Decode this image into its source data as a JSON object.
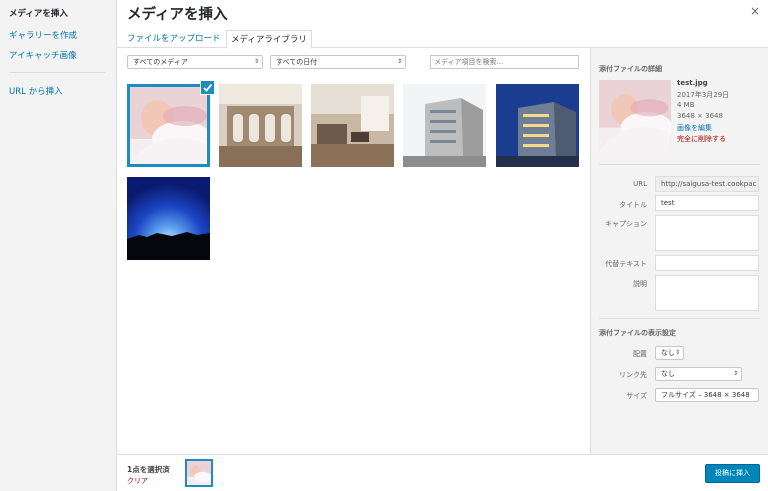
{
  "menu": {
    "title": "メディアを挿入",
    "items": [
      "ギャラリーを作成",
      "アイキャッチ画像"
    ],
    "url_insert": "URL から挿入"
  },
  "header": {
    "title": "メディアを挿入",
    "close_icon": "×"
  },
  "tabs": [
    {
      "label": "ファイルをアップロード",
      "active": false
    },
    {
      "label": "メディアライブラリ",
      "active": true
    }
  ],
  "toolbar": {
    "media_filter": "すべてのメディア",
    "date_filter": "すべての日付",
    "search_placeholder": "メディア項目を検索..."
  },
  "attachments": [
    {
      "name": "baby-photo",
      "selected": true
    },
    {
      "name": "lobby-photo",
      "selected": false
    },
    {
      "name": "living-room-photo",
      "selected": false
    },
    {
      "name": "building-day-photo",
      "selected": false
    },
    {
      "name": "building-night-photo",
      "selected": false
    },
    {
      "name": "sunset-photo",
      "selected": false
    }
  ],
  "details": {
    "heading": "添付ファイルの詳細",
    "filename": "test.jpg",
    "date": "2017年3月29日",
    "size": "4 MB",
    "dimensions": "3648 × 3648",
    "edit_link": "画像を編集",
    "delete_link": "完全に削除する"
  },
  "fields": {
    "url_label": "URL",
    "url_value": "http://saigusa-test.cookpac",
    "title_label": "タイトル",
    "title_value": "test",
    "caption_label": "キャプション",
    "caption_value": "",
    "alt_label": "代替テキスト",
    "alt_value": "",
    "description_label": "説明",
    "description_value": ""
  },
  "display_settings": {
    "heading": "添付ファイルの表示設定",
    "align_label": "配置",
    "align_value": "なし",
    "link_label": "リンク先",
    "link_value": "なし",
    "size_label": "サイズ",
    "size_value": "フルサイズ – 3648 × 3648"
  },
  "footer": {
    "selected_count": "1点を選択済",
    "clear_label": "クリア",
    "insert_button": "投稿に挿入"
  },
  "colors": {
    "accent": "#0073aa",
    "selected_border": "#1e8cbe",
    "primary_button": "#0085ba",
    "delete": "#aa0000"
  }
}
